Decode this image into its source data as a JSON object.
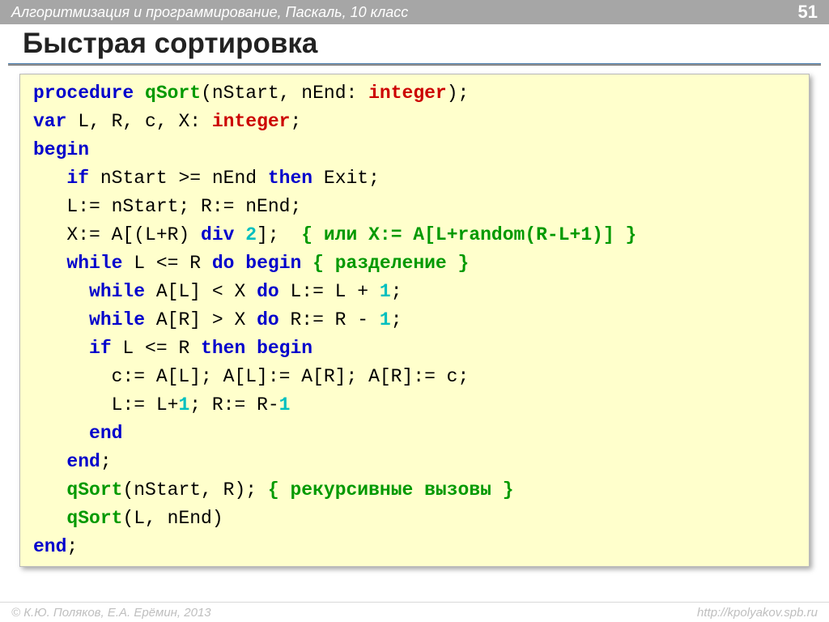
{
  "header": {
    "course": "Алгоритмизация и программирование, Паскаль, 10 класс",
    "page": "51"
  },
  "title": "Быстрая сортировка",
  "code": {
    "l1": {
      "kw_proc": "procedure",
      "fn": "qSort",
      "args": "(nStart, nEnd: ",
      "typ": "integer",
      "close": ");"
    },
    "l2": {
      "kw_var": "var",
      "rest": " L, R, c, X: ",
      "typ": "integer",
      "semi": ";"
    },
    "l3": {
      "kw_begin": "begin"
    },
    "l4": {
      "kw_if": "if",
      "cond": " nStart >= nEnd ",
      "kw_then": "then",
      "exit": " Exit;"
    },
    "l5": {
      "text": "   L:= nStart; R:= nEnd;"
    },
    "l6": {
      "a": "   X:= A[(L+R)",
      "kw_div": " div ",
      "num": "2",
      "b": "];  ",
      "cmt": "{ или X:= A[L+random(R-L+1)] }"
    },
    "l7": {
      "sp": "   ",
      "kw_while": "while",
      "cond": " L <= R ",
      "kw_do": "do",
      "sp2": " ",
      "kw_begin": "begin",
      "sp3": " ",
      "cmt": "{ разделение }"
    },
    "l8": {
      "sp": "     ",
      "kw_while": "while",
      "cond": " A[L] < X ",
      "kw_do": "do",
      "rest": " L:= L + ",
      "num": "1",
      "semi": ";"
    },
    "l9": {
      "sp": "     ",
      "kw_while": "while",
      "cond": " A[R] > X ",
      "kw_do": "do",
      "rest": " R:= R - ",
      "num": "1",
      "semi": ";"
    },
    "l10": {
      "sp": "     ",
      "kw_if": "if",
      "cond": " L <= R ",
      "kw_then": "then",
      "sp2": " ",
      "kw_begin": "begin"
    },
    "l11": {
      "text": "       c:= A[L]; A[L]:= A[R]; A[R]:= c;"
    },
    "l12": {
      "a": "       L:= L+",
      "n1": "1",
      "b": "; R:= R-",
      "n2": "1"
    },
    "l13": {
      "sp": "     ",
      "kw_end": "end"
    },
    "l14": {
      "sp": "   ",
      "kw_end": "end",
      "semi": ";"
    },
    "l15": {
      "sp": "   ",
      "fn": "qSort",
      "args": "(nStart, R); ",
      "cmt": "{ рекурсивные вызовы }"
    },
    "l16": {
      "sp": "   ",
      "fn": "qSort",
      "args": "(L, nEnd)"
    },
    "l17": {
      "kw_end": "end",
      "semi": ";"
    }
  },
  "footer": {
    "left": "© К.Ю. Поляков, Е.А. Ерёмин, 2013",
    "right": "http://kpolyakov.spb.ru"
  }
}
